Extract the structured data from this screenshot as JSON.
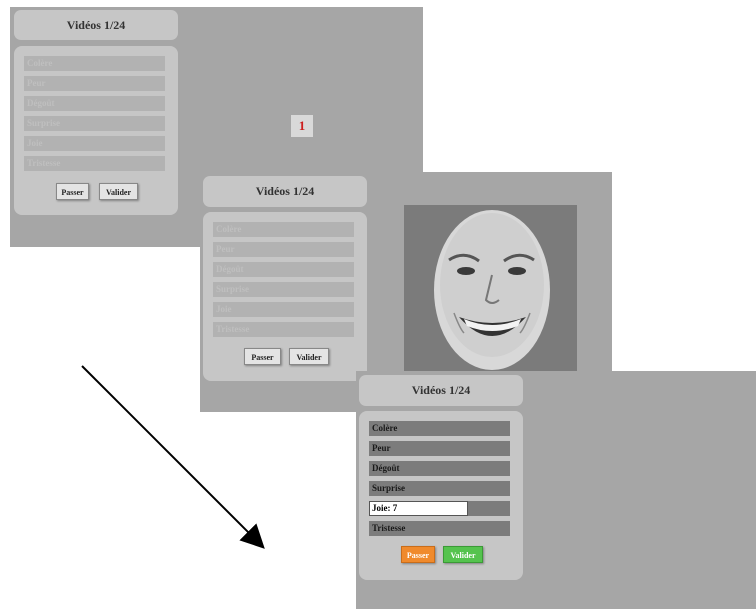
{
  "screens": [
    {
      "header": "Vidéos 1/24",
      "fixation": "1",
      "emotions": [
        {
          "label": "Colère"
        },
        {
          "label": "Peur"
        },
        {
          "label": "Dégoût"
        },
        {
          "label": "Surprise"
        },
        {
          "label": "Joie"
        },
        {
          "label": "Tristesse"
        }
      ],
      "buttons": {
        "skip": "Passer",
        "validate": "Valider"
      }
    },
    {
      "header": "Vidéos 1/24",
      "emotions": [
        {
          "label": "Colère"
        },
        {
          "label": "Peur"
        },
        {
          "label": "Dégoût"
        },
        {
          "label": "Surprise"
        },
        {
          "label": "Joie"
        },
        {
          "label": "Tristesse"
        }
      ],
      "buttons": {
        "skip": "Passer",
        "validate": "Valider"
      }
    },
    {
      "header": "Vidéos 1/24",
      "emotions": [
        {
          "label": "Colère"
        },
        {
          "label": "Peur"
        },
        {
          "label": "Dégoût"
        },
        {
          "label": "Surprise"
        },
        {
          "label": "Joie: 7",
          "rating_fraction": 0.7
        },
        {
          "label": "Tristesse"
        }
      ],
      "buttons": {
        "skip": "Passer",
        "validate": "Valider"
      }
    }
  ],
  "colors": {
    "screen_bg": "#a6a6a6",
    "panel_bg": "#c6c6c6",
    "fixation_text": "#cc1e1e",
    "skip_active": "#f08a2c",
    "validate_active": "#55c34e"
  }
}
